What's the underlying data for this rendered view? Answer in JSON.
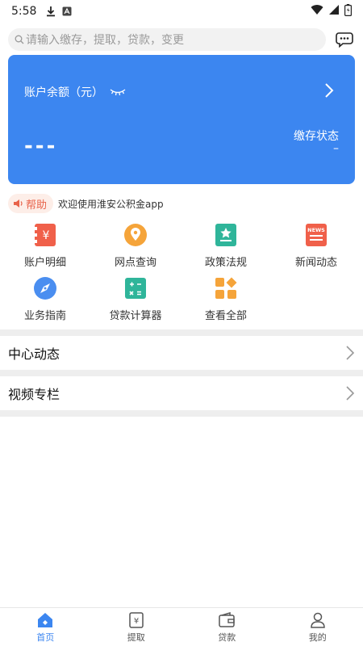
{
  "status_bar": {
    "time": "5:58"
  },
  "search": {
    "placeholder": "请输入缴存，提取，贷款，变更"
  },
  "balance_card": {
    "label": "账户余额（元）",
    "amount": "---",
    "status_label": "缴存状态",
    "status_value": "–"
  },
  "notice": {
    "help_label": "帮助",
    "text": "欢迎使用淮安公积金app"
  },
  "grid": {
    "items": [
      {
        "label": "账户明细",
        "icon": "account-detail-icon"
      },
      {
        "label": "网点查询",
        "icon": "location-pin-icon"
      },
      {
        "label": "政策法规",
        "icon": "policy-star-icon"
      },
      {
        "label": "新闻动态",
        "icon": "news-icon"
      },
      {
        "label": "业务指南",
        "icon": "compass-icon"
      },
      {
        "label": "贷款计算器",
        "icon": "calculator-icon"
      },
      {
        "label": "查看全部",
        "icon": "all-apps-icon"
      }
    ]
  },
  "sections": [
    {
      "title": "中心动态"
    },
    {
      "title": "视频专栏"
    }
  ],
  "tabbar": {
    "tabs": [
      {
        "label": "首页",
        "active": true
      },
      {
        "label": "提取",
        "active": false
      },
      {
        "label": "贷款",
        "active": false
      },
      {
        "label": "我的",
        "active": false
      }
    ]
  },
  "colors": {
    "primary": "#3c86f0",
    "help_text": "#e8634a",
    "help_bg": "#fdeee8",
    "separator": "#eeeeee"
  }
}
